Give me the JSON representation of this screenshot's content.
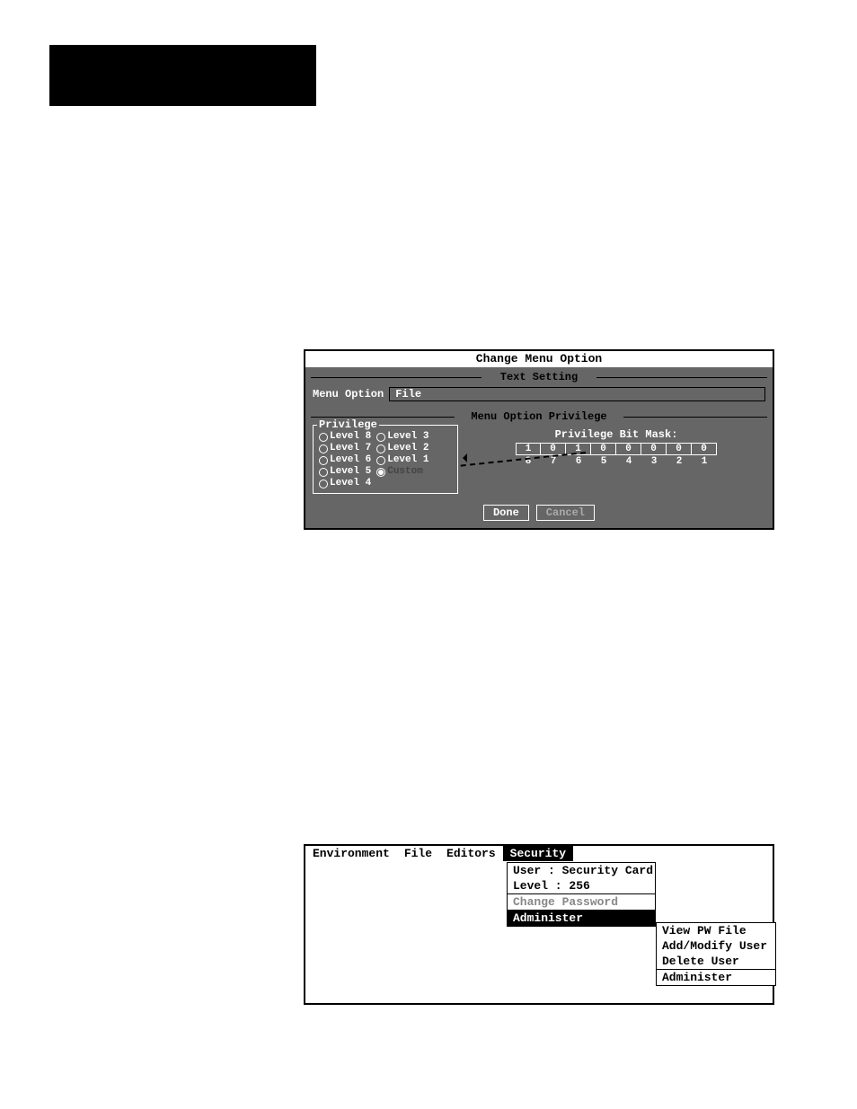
{
  "dialog": {
    "title": "Change Menu Option",
    "section_text": "Text Setting",
    "section_priv": "Menu Option Privilege",
    "field_label": "Menu Option",
    "field_value": "File",
    "priv_box_title": "Privilege",
    "levels_col1": [
      "Level 8",
      "Level 7",
      "Level 6",
      "Level 5",
      "Level 4"
    ],
    "levels_col2": [
      "Level 3",
      "Level 2",
      "Level 1",
      "Custom"
    ],
    "selected_level": "Custom",
    "mask_title": "Privilege Bit Mask:",
    "mask_bits": [
      "1",
      "0",
      "1",
      "0",
      "0",
      "0",
      "0",
      "0"
    ],
    "mask_indices": [
      "8",
      "7",
      "6",
      "5",
      "4",
      "3",
      "2",
      "1"
    ],
    "buttons": {
      "done": "Done",
      "cancel": "Cancel"
    }
  },
  "menushot": {
    "menubar": [
      "Environment",
      "File",
      "Editors",
      "Security"
    ],
    "menubar_selected": "Security",
    "dropdown": {
      "user_line": "User : Security Card",
      "level_line": "Level : 256",
      "change_pw": "Change Password",
      "administer": "Administer"
    },
    "submenu": {
      "items": [
        "View PW File",
        "Add/Modify User",
        "Delete User"
      ],
      "administer": "Administer"
    }
  }
}
